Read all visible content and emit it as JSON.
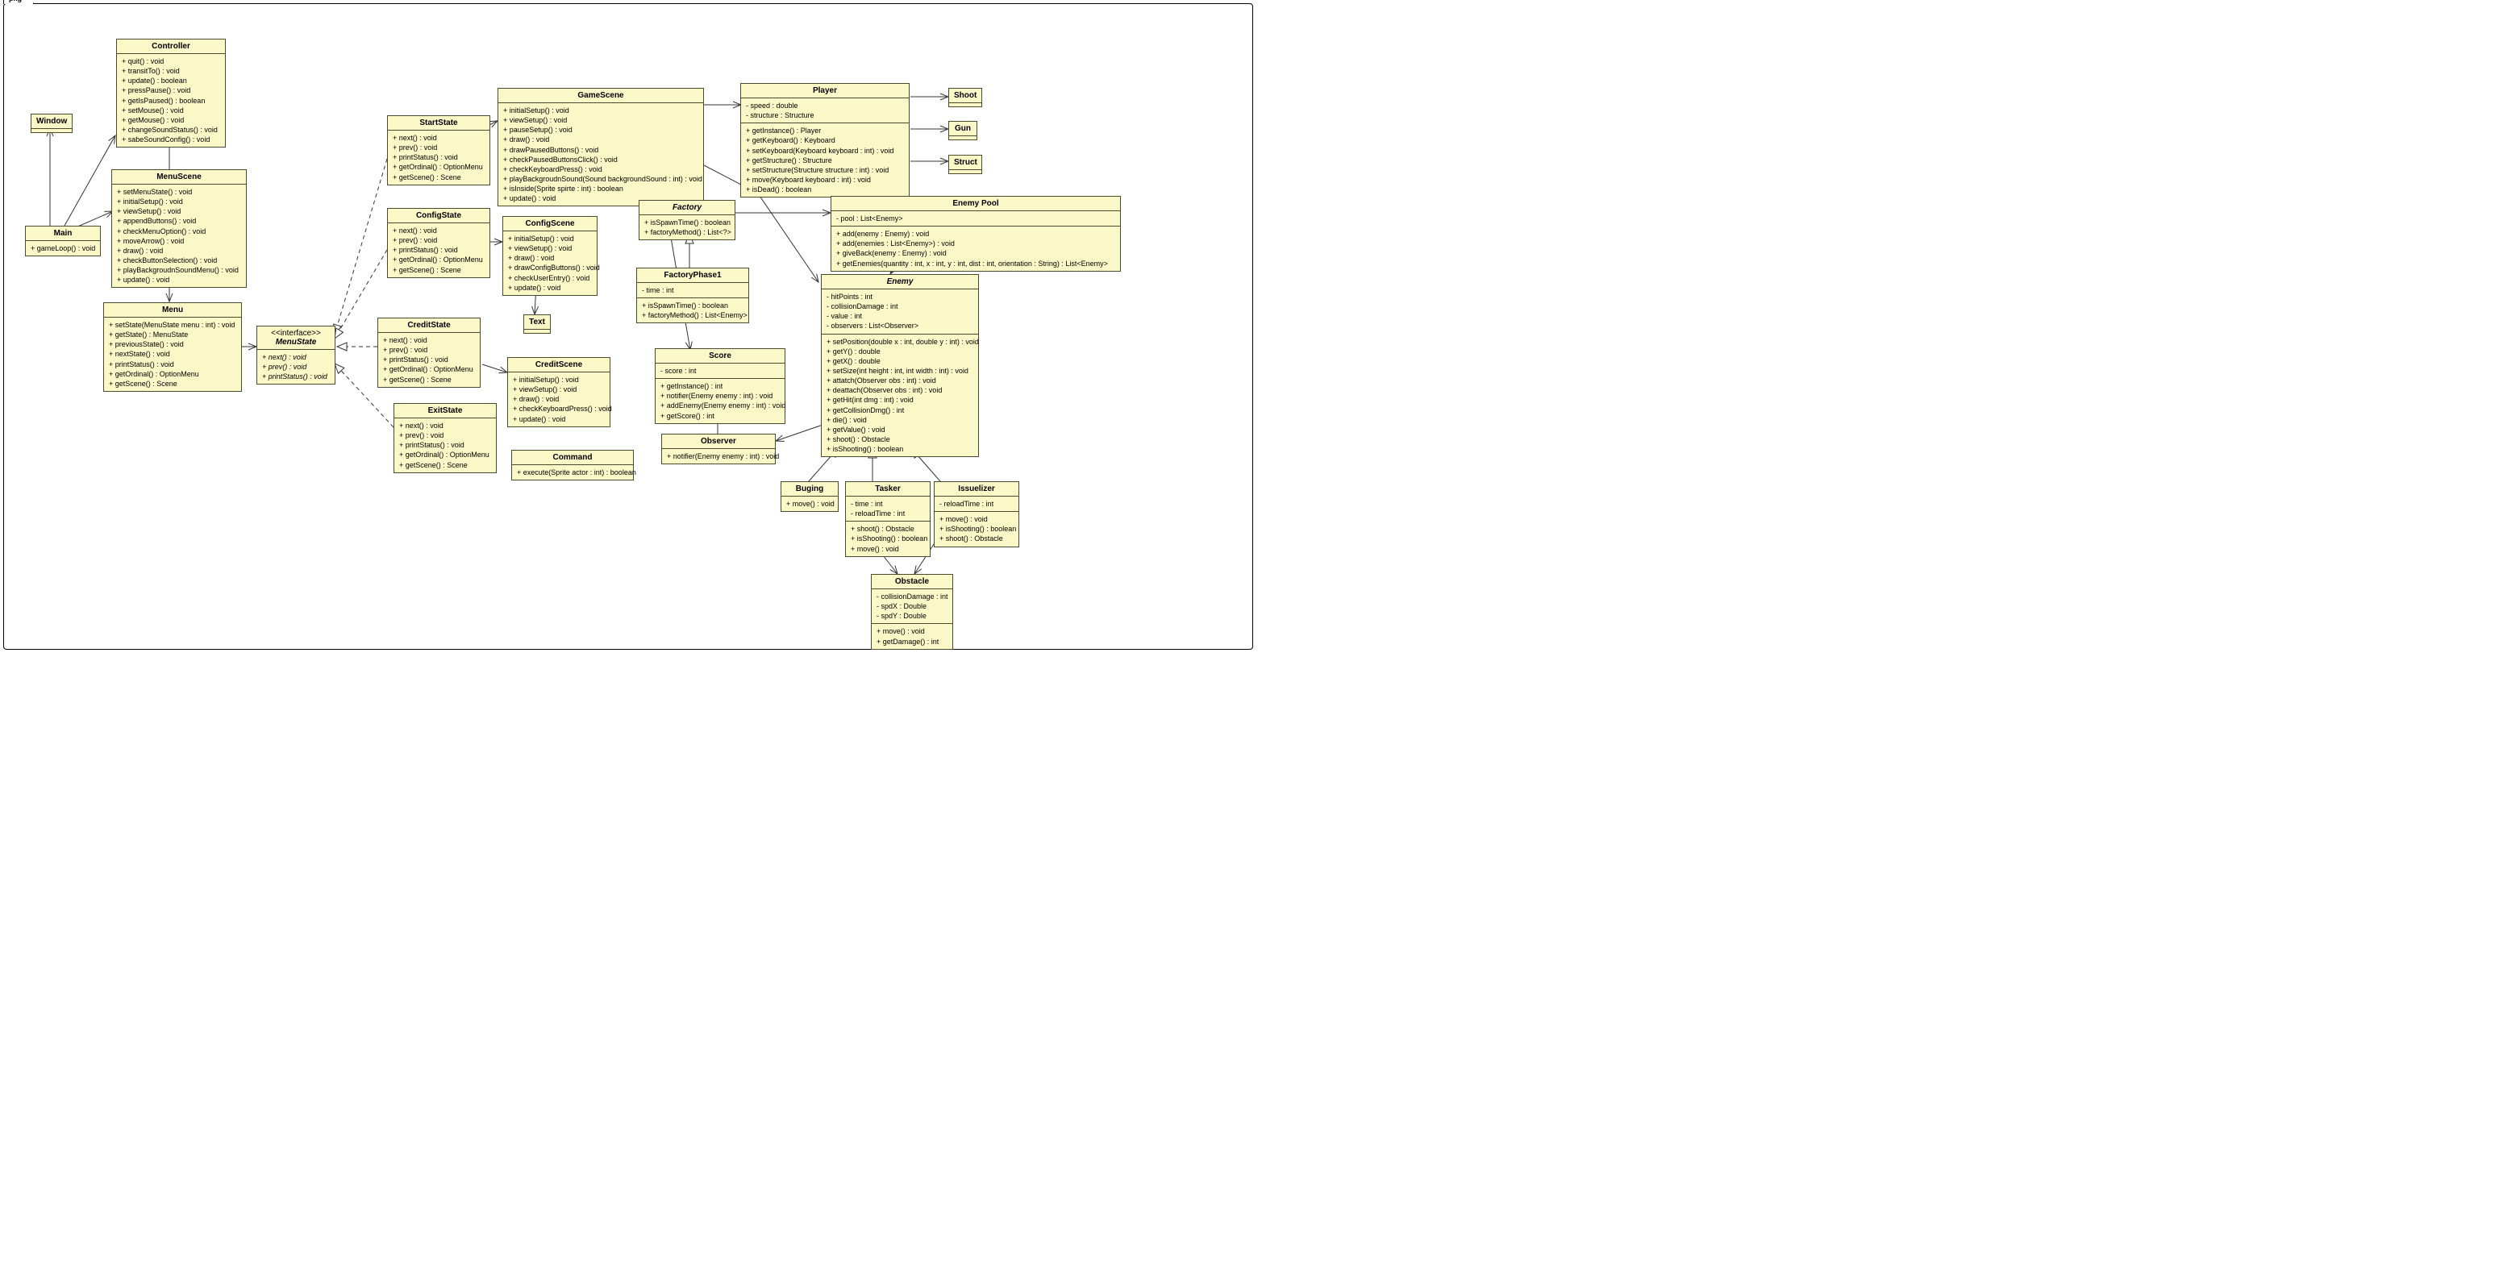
{
  "package": {
    "label": "pkg"
  },
  "classes": {
    "window": {
      "name": "Window"
    },
    "controller": {
      "name": "Controller",
      "ops": [
        "+ quit() : void",
        "+ transitTo() : void",
        "+ update() : boolean",
        "+ pressPause() : void",
        "+ getIsPaused() : boolean",
        "+ setMouse() : void",
        "+ getMouse() : void",
        "+ changeSoundStatus() : void",
        "+ sabeSoundConfig() : void"
      ]
    },
    "main": {
      "name": "Main",
      "ops": [
        "+ gameLoop() : void"
      ]
    },
    "menuscene": {
      "name": "MenuScene",
      "ops": [
        "+ setMenuState() : void",
        "+ initialSetup() : void",
        "+ viewSetup() : void",
        "+ appendButtons() : void",
        "+ checkMenuOption() : void",
        "+ moveArrow() : void",
        "+ draw() : void",
        "+ checkButtonSelection() : void",
        "+ playBackgroudnSoundMenu() : void",
        "+ update() : void"
      ]
    },
    "menu": {
      "name": "Menu",
      "ops": [
        "+ setState(MenuState menu : int) : void",
        "+ getState() : MenuState",
        "+ previousState() : void",
        "+ nextState() : void",
        "+ printStatus() : void",
        "+ getOrdinal() : OptionMenu",
        "+ getScene() : Scene"
      ]
    },
    "menustate": {
      "stereotype": "<<interface>>",
      "name": "MenuState",
      "ops": [
        "+ next() : void",
        "+ prev() : void",
        "+ printStatus() : void"
      ]
    },
    "startstate": {
      "name": "StartState",
      "ops": [
        "+ next() : void",
        "+ prev() : void",
        "+ printStatus() : void",
        "+ getOrdinal() : OptionMenu",
        "+ getScene() : Scene"
      ]
    },
    "configstate": {
      "name": "ConfigState",
      "ops": [
        "+ next() : void",
        "+ prev() : void",
        "+ printStatus() : void",
        "+ getOrdinal() : OptionMenu",
        "+ getScene() : Scene"
      ]
    },
    "creditstate": {
      "name": "CreditState",
      "ops": [
        "+ next() : void",
        "+ prev() : void",
        "+ printStatus() : void",
        "+ getOrdinal() : OptionMenu",
        "+ getScene() : Scene"
      ]
    },
    "exitstate": {
      "name": "ExitState",
      "ops": [
        "+ next() : void",
        "+ prev() : void",
        "+ printStatus() : void",
        "+ getOrdinal() : OptionMenu",
        "+ getScene() : Scene"
      ]
    },
    "gamescene": {
      "name": "GameScene",
      "ops": [
        "+ initialSetup() : void",
        "+ viewSetup() : void",
        "+ pauseSetup() : void",
        "+ draw() : void",
        "+ drawPausedButtons() : void",
        "+ checkPausedButtonsClick() : void",
        "+ checkKeyboardPress() : void",
        "+ playBackgroudnSound(Sound  backgroundSound : int) : void",
        "+ isInside(Sprite spirte : int) : boolean",
        "+ update() : void"
      ]
    },
    "configscene": {
      "name": "ConfigScene",
      "ops": [
        "+ initialSetup() : void",
        "+ viewSetup() : void",
        "+ draw() : void",
        "+ drawConfigButtons() : void",
        "+ checkUserEntry() : void",
        "+ update() : void"
      ]
    },
    "creditscene": {
      "name": "CreditScene",
      "ops": [
        "+ initialSetup() : void",
        "+ viewSetup() : void",
        "+ draw() : void",
        "+ checkKeyboardPress() : void",
        "+ update() : void"
      ]
    },
    "text": {
      "name": "Text"
    },
    "command": {
      "name": "Command",
      "ops": [
        "+ execute(Sprite actor : int) : boolean"
      ]
    },
    "factory": {
      "name": "Factory",
      "ops": [
        "+ isSpawnTime() : boolean",
        "+ factoryMethod() : List<?>"
      ]
    },
    "factoryphase1": {
      "name": "FactoryPhase1",
      "attrs": [
        "- time : int"
      ],
      "ops": [
        "+ isSpawnTime() : boolean",
        "+ factoryMethod() : List<Enemy>"
      ]
    },
    "score": {
      "name": "Score",
      "attrs": [
        "- score : int"
      ],
      "ops": [
        "+ getInstance() : int",
        "+ notifier(Enemy enemy : int) : void",
        "+ addEnemy(Enemy enemy : int) : void",
        "+ getScore() : int"
      ]
    },
    "observer": {
      "name": "Observer",
      "ops": [
        "+ notifier(Enemy enemy : int) : void"
      ]
    },
    "player": {
      "name": "Player",
      "attrs": [
        "- speed : double",
        "- structure : Structure"
      ],
      "ops": [
        "+ getInstance() : Player",
        "+ getKeyboard() : Keyboard",
        "+ setKeyboard(Keyboard keyboard : int) : void",
        "+ getStructure() : Structure",
        "+ setStructure(Structure structure : int) : void",
        "+ move(Keyboard keyboard : int) : void",
        "+ isDead() : boolean"
      ]
    },
    "shoot": {
      "name": "Shoot"
    },
    "gun": {
      "name": "Gun"
    },
    "struct": {
      "name": "Struct"
    },
    "enemypool": {
      "name": "Enemy Pool",
      "attrs": [
        "- pool : List<Enemy>"
      ],
      "ops": [
        "+ add(enemy : Enemy) : void",
        "+ add(enemies : List<Enemy>) : void",
        "+ giveBack(enemy : Enemy) : void",
        "+ getEnemies(quantity : int, x : int, y : int, dist : int, orientation : String) : List<Enemy>"
      ]
    },
    "enemy": {
      "name": "Enemy",
      "attrs": [
        "- hitPoints : int",
        "- collisionDamage : int",
        "- value : int",
        "- observers : List<Observer>"
      ],
      "ops": [
        "+ setPosition(double x : int, double y : int) : void",
        "+ getY() : double",
        "+ getX() : double",
        "+ setSize(int height : int, int width : int) : void",
        "+ attatch(Observer obs : int) : void",
        "+ deattach(Observer obs : int) : void",
        "+ getHit(int dmg : int) : void",
        "+ getCollisionDmg() : int",
        "+ die() : void",
        "+ getValue() : void",
        "+ shoot() : Obstacle",
        "+ isShooting() : boolean"
      ]
    },
    "buging": {
      "name": "Buging",
      "ops": [
        "+ move() : void"
      ]
    },
    "tasker": {
      "name": "Tasker",
      "attrs": [
        "- time : int",
        "- reloadTime : int"
      ],
      "ops": [
        "+ shoot() : Obstacle",
        "+ isShooting() : boolean",
        "+ move() : void"
      ]
    },
    "issuelizer": {
      "name": "Issuelizer",
      "attrs": [
        "- reloadTime : int"
      ],
      "ops": [
        "+ move() : void",
        "+ isShooting() : boolean",
        "+ shoot() : Obstacle"
      ]
    },
    "obstacle": {
      "name": "Obstacle",
      "attrs": [
        "- collisionDamage : int",
        "- spdX : Double",
        "- spdY : Double"
      ],
      "ops": [
        "+ move() : void",
        "+ getDamage() : int"
      ]
    }
  }
}
